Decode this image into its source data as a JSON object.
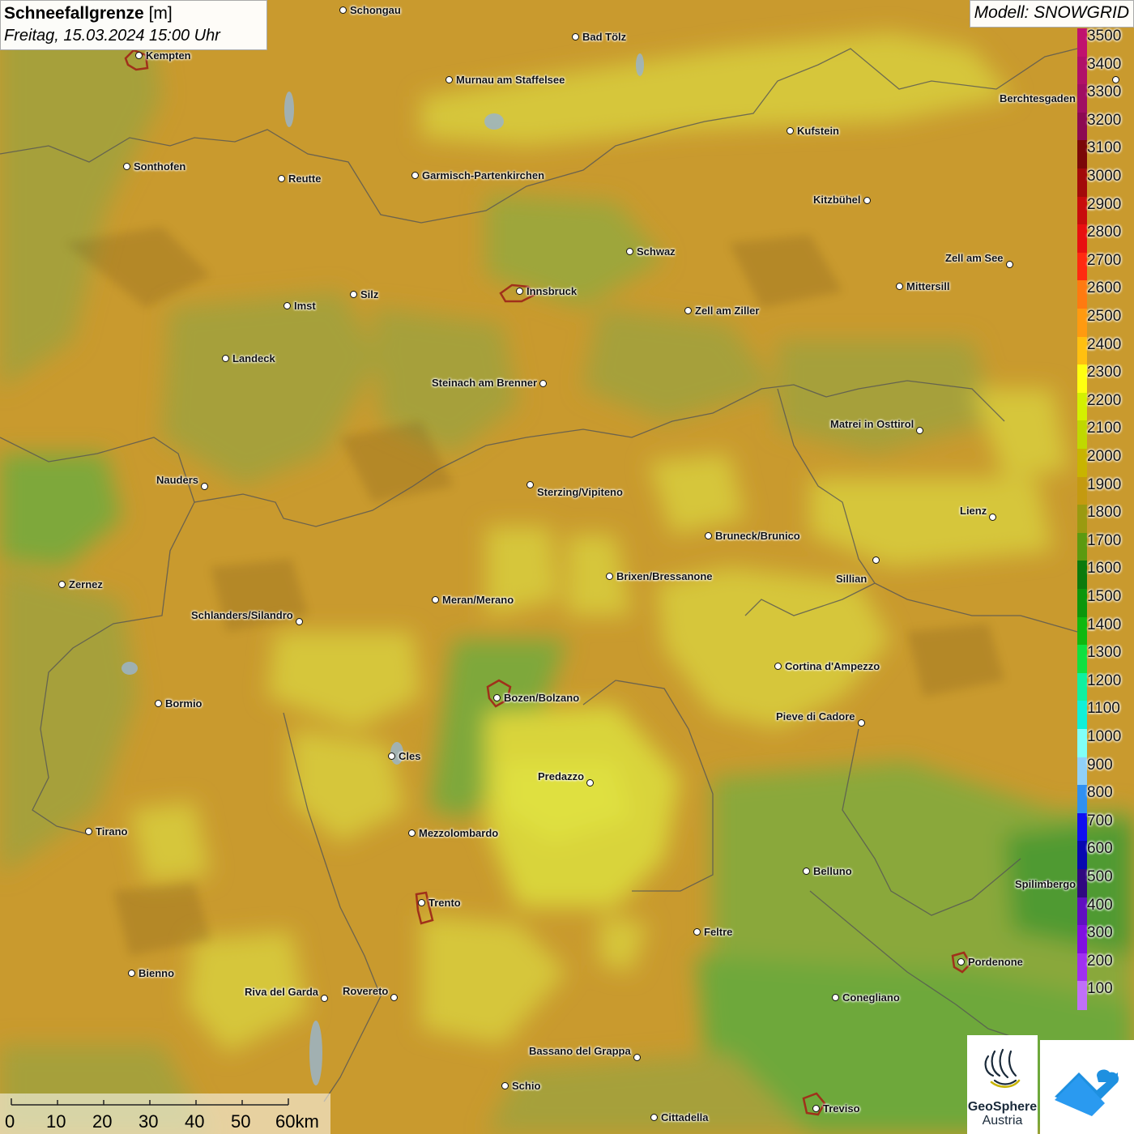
{
  "header": {
    "title_bold": "Schneefallgrenze",
    "title_unit": " [m]",
    "datetime": "Freitag, 15.03.2024 15:00 Uhr"
  },
  "model": {
    "label": "Modell: SNOWGRID"
  },
  "legend": {
    "items": [
      {
        "label": "3500",
        "color": "#c0126e"
      },
      {
        "label": "3400",
        "color": "#b01068"
      },
      {
        "label": "3300",
        "color": "#a00e62"
      },
      {
        "label": "3200",
        "color": "#8c0a52"
      },
      {
        "label": "3100",
        "color": "#7a0808"
      },
      {
        "label": "3000",
        "color": "#a20a0a"
      },
      {
        "label": "2900",
        "color": "#c80c0c"
      },
      {
        "label": "2800",
        "color": "#e81010"
      },
      {
        "label": "2700",
        "color": "#ff2a10"
      },
      {
        "label": "2600",
        "color": "#ff7a10"
      },
      {
        "label": "2500",
        "color": "#ff9a10"
      },
      {
        "label": "2400",
        "color": "#ffc010"
      },
      {
        "label": "2300",
        "color": "#ffff10"
      },
      {
        "label": "2200",
        "color": "#d4f000"
      },
      {
        "label": "2100",
        "color": "#c0d800"
      },
      {
        "label": "2000",
        "color": "#c8b400"
      },
      {
        "label": "1900",
        "color": "#c49a10"
      },
      {
        "label": "1800",
        "color": "#9a9a10"
      },
      {
        "label": "1700",
        "color": "#5c9a10"
      },
      {
        "label": "1600",
        "color": "#0c7a0c"
      },
      {
        "label": "1500",
        "color": "#0c960c"
      },
      {
        "label": "1400",
        "color": "#10b810"
      },
      {
        "label": "1300",
        "color": "#10e040"
      },
      {
        "label": "1200",
        "color": "#10f0a0"
      },
      {
        "label": "1100",
        "color": "#10f0d8"
      },
      {
        "label": "1000",
        "color": "#80fff8"
      },
      {
        "label": "900",
        "color": "#90d0f8"
      },
      {
        "label": "800",
        "color": "#3090f0"
      },
      {
        "label": "700",
        "color": "#1010f0"
      },
      {
        "label": "600",
        "color": "#0808b0"
      },
      {
        "label": "500",
        "color": "#300880"
      },
      {
        "label": "400",
        "color": "#6010c0"
      },
      {
        "label": "300",
        "color": "#8010e0"
      },
      {
        "label": "200",
        "color": "#a030f0"
      },
      {
        "label": "100",
        "color": "#c070f8"
      }
    ]
  },
  "cities": [
    {
      "name": "Schongau"
    },
    {
      "name": "Bad Tölz"
    },
    {
      "name": "Kempten"
    },
    {
      "name": "Murnau am Staffelsee"
    },
    {
      "name": "Berchtesgaden"
    },
    {
      "name": "Kufstein"
    },
    {
      "name": "Sonthofen"
    },
    {
      "name": "Reutte"
    },
    {
      "name": "Garmisch-Partenkirchen"
    },
    {
      "name": "Kitzbühel"
    },
    {
      "name": "Schwaz"
    },
    {
      "name": "Zell am See"
    },
    {
      "name": "Mittersill"
    },
    {
      "name": "Innsbruck"
    },
    {
      "name": "Silz"
    },
    {
      "name": "Imst"
    },
    {
      "name": "Zell am Ziller"
    },
    {
      "name": "Landeck"
    },
    {
      "name": "Steinach am Brenner"
    },
    {
      "name": "Matrei in Osttirol"
    },
    {
      "name": "Nauders"
    },
    {
      "name": "Sterzing/Vipiteno"
    },
    {
      "name": "Lienz"
    },
    {
      "name": "Bruneck/Brunico"
    },
    {
      "name": "Sillian"
    },
    {
      "name": "Zernez"
    },
    {
      "name": "Brixen/Bressanone"
    },
    {
      "name": "Meran/Merano"
    },
    {
      "name": "Schlanders/Silandro"
    },
    {
      "name": "Cortina d'Ampezzo"
    },
    {
      "name": "Bormio"
    },
    {
      "name": "Bozen/Bolzano"
    },
    {
      "name": "Pieve di Cadore"
    },
    {
      "name": "Cles"
    },
    {
      "name": "Predazzo"
    },
    {
      "name": "Tirano"
    },
    {
      "name": "Mezzolombardo"
    },
    {
      "name": "Belluno"
    },
    {
      "name": "Spilimbergo"
    },
    {
      "name": "Trento"
    },
    {
      "name": "Feltre"
    },
    {
      "name": "Pordenone"
    },
    {
      "name": "Bienno"
    },
    {
      "name": "Riva del Garda"
    },
    {
      "name": "Rovereto"
    },
    {
      "name": "Conegliano"
    },
    {
      "name": "Bassano del Grappa"
    },
    {
      "name": "Schio"
    },
    {
      "name": "Treviso"
    },
    {
      "name": "Cittadella"
    }
  ],
  "scale": {
    "ticks": [
      "0",
      "10",
      "20",
      "30",
      "40",
      "50",
      "60km"
    ]
  },
  "logos": {
    "geosphere_title": "GeoSphere",
    "geosphere_sub": "Austria"
  }
}
